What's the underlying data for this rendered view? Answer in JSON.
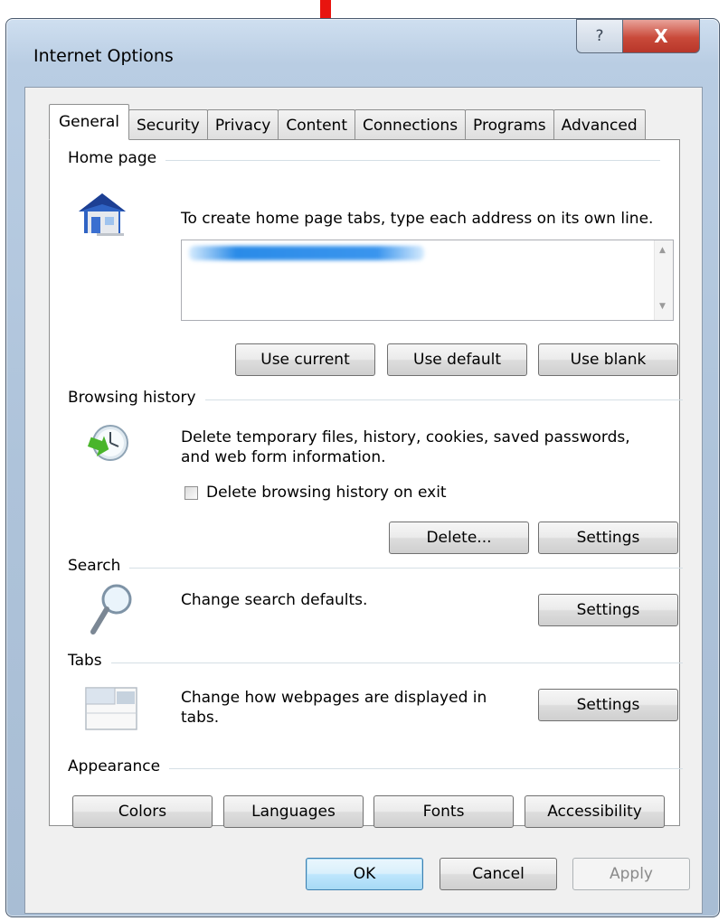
{
  "window": {
    "title": "Internet Options",
    "help_label": "?",
    "close_label": "X"
  },
  "tabs": [
    {
      "label": "General",
      "active": true
    },
    {
      "label": "Security"
    },
    {
      "label": "Privacy"
    },
    {
      "label": "Content"
    },
    {
      "label": "Connections"
    },
    {
      "label": "Programs"
    },
    {
      "label": "Advanced"
    }
  ],
  "home_page": {
    "heading": "Home page",
    "description": "To create home page tabs, type each address on its own line.",
    "buttons": {
      "use_current": "Use current",
      "use_default": "Use default",
      "use_blank": "Use blank"
    }
  },
  "browsing_history": {
    "heading": "Browsing history",
    "description_line1": "Delete temporary files, history, cookies, saved passwords,",
    "description_line2": "and web form information.",
    "checkbox_label": "Delete browsing history on exit",
    "checkbox_checked": false,
    "buttons": {
      "delete": "Delete...",
      "settings": "Settings"
    }
  },
  "search": {
    "heading": "Search",
    "description": "Change search defaults.",
    "settings": "Settings"
  },
  "tabs_section": {
    "heading": "Tabs",
    "description_line1": "Change how webpages are displayed in",
    "description_line2": "tabs.",
    "settings": "Settings"
  },
  "appearance": {
    "heading": "Appearance",
    "buttons": {
      "colors": "Colors",
      "languages": "Languages",
      "fonts": "Fonts",
      "accessibility": "Accessibility"
    }
  },
  "footer": {
    "ok": "OK",
    "cancel": "Cancel",
    "apply": "Apply"
  },
  "colors": {
    "annotation_arrow": "#e8140f",
    "close_button": "#c94a3a"
  }
}
